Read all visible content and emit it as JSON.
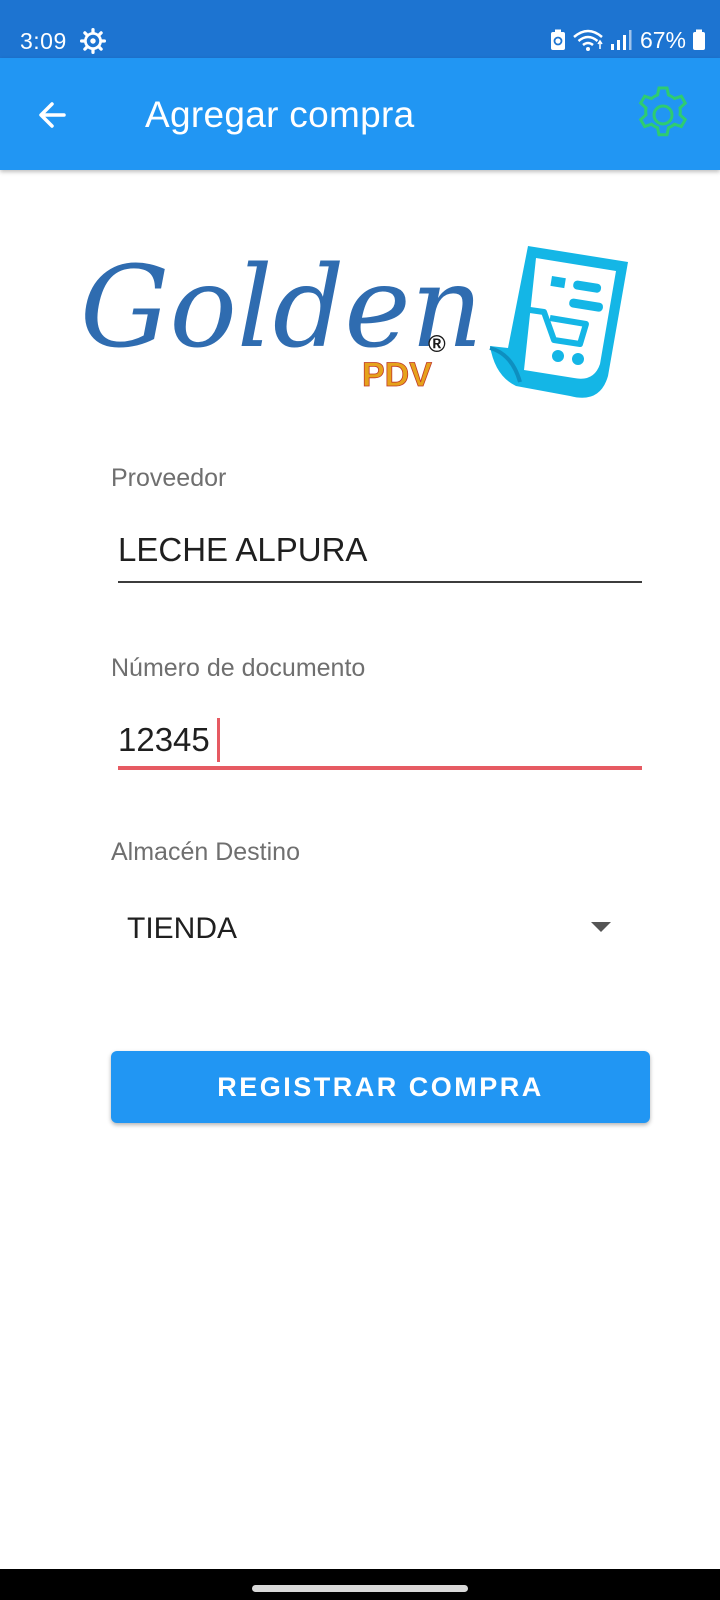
{
  "status_bar": {
    "time": "3:09",
    "battery": "67%",
    "icons": [
      "settings-gear-icon",
      "battery-saver-icon",
      "wifi-icon",
      "signal-icon",
      "battery-icon"
    ]
  },
  "app_bar": {
    "title": "Agregar compra",
    "back_icon": "arrow-back-icon",
    "settings_icon": "gear-icon",
    "colors": {
      "background": "#2196f3",
      "settings_icon": "#2ecc71"
    }
  },
  "logo": {
    "brand": "Golden",
    "sub": "PDV",
    "registered": "®",
    "icon": "receipt-cart-icon"
  },
  "form": {
    "proveedor": {
      "label": "Proveedor",
      "value": "LECHE ALPURA"
    },
    "documento": {
      "label": "Número de documento",
      "value": "12345"
    },
    "almacen": {
      "label": "Almacén Destino",
      "selected": "TIENDA"
    },
    "submit_label": "REGISTRAR COMPRA"
  },
  "colors": {
    "accent": "#2196f3",
    "error_underline": "#e65a62",
    "status_bar": "#1d74d1"
  }
}
